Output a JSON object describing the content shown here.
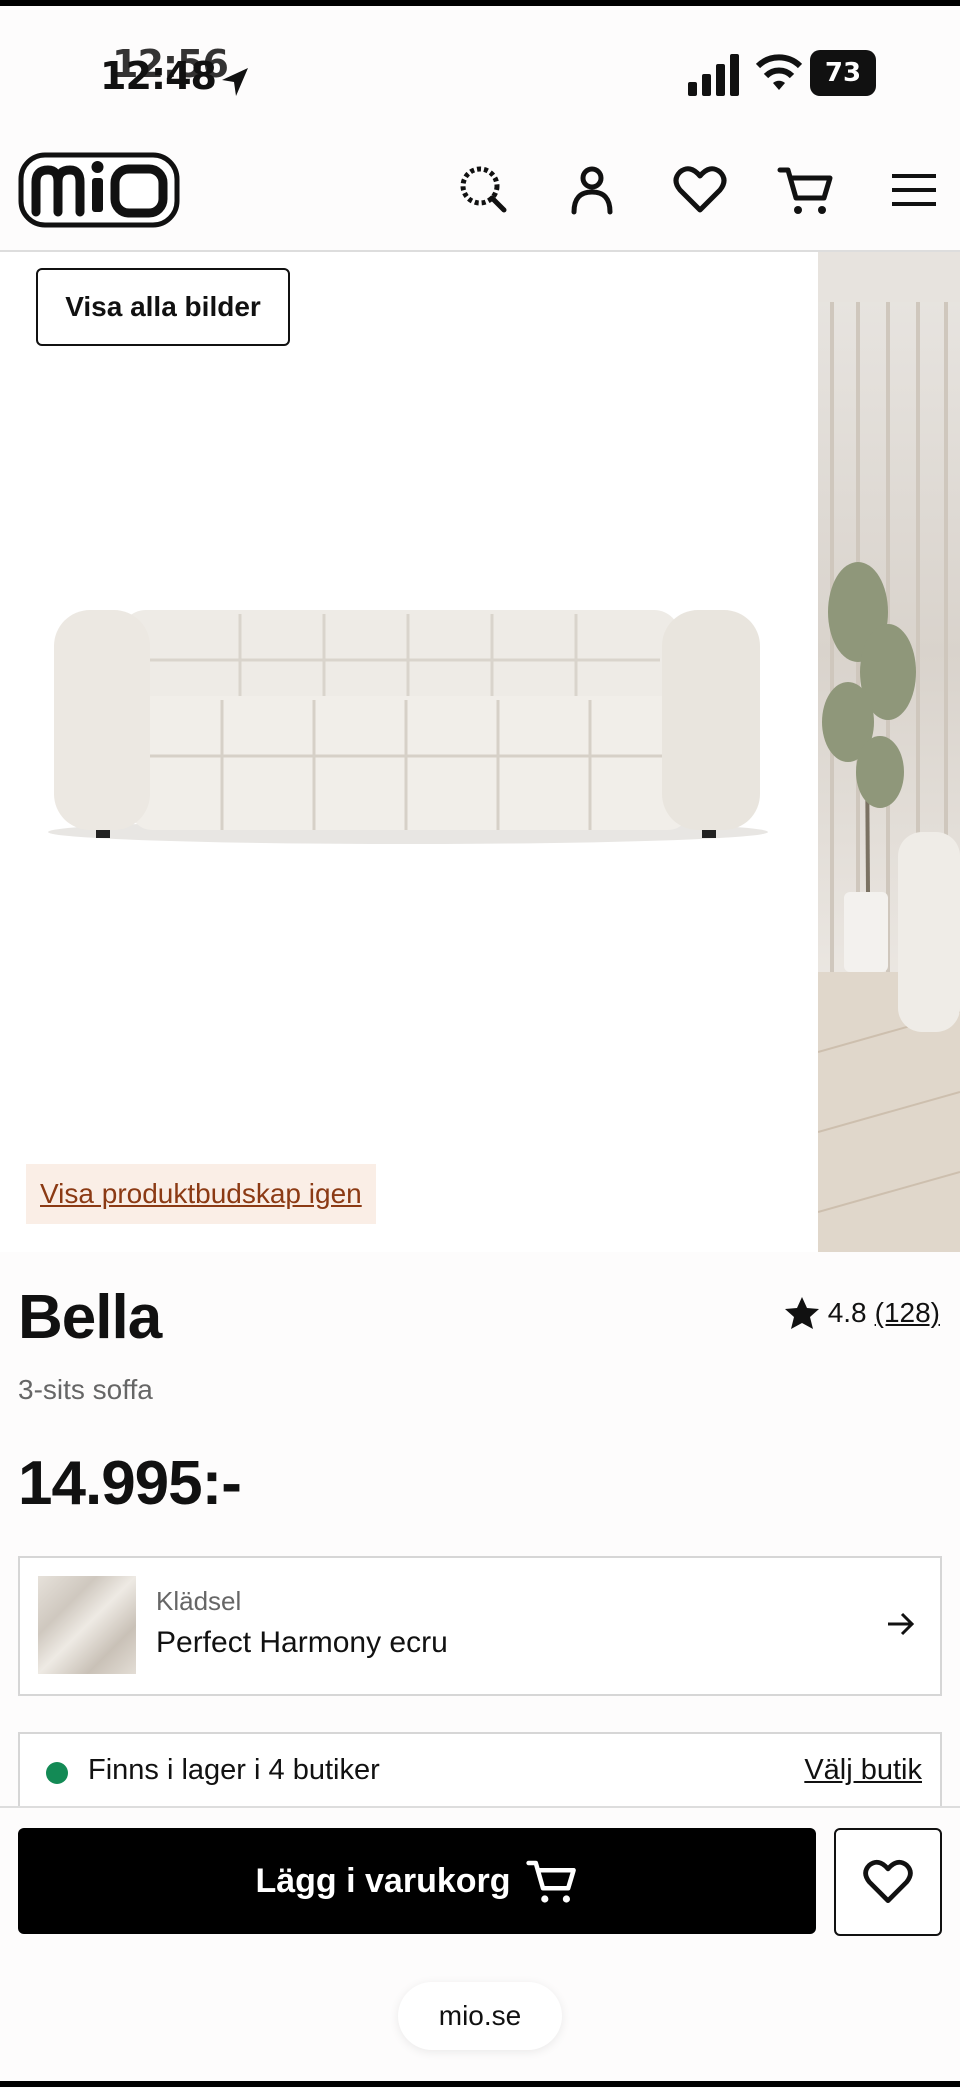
{
  "status_bar": {
    "time_primary": "12:48",
    "time_ghost": "12:56",
    "battery": "73"
  },
  "header": {
    "logo_text": "mio",
    "icons": [
      "search-icon",
      "account-icon",
      "heart-icon",
      "cart-icon",
      "menu-icon"
    ]
  },
  "gallery": {
    "show_all_label": "Visa alla bilder",
    "product_message_link": "Visa produktbudskap igen"
  },
  "product": {
    "name": "Bella",
    "subtitle": "3-sits soffa",
    "rating": "4.8",
    "review_count": "(128)",
    "price": "14.995:-"
  },
  "fabric": {
    "label": "Klädsel",
    "value": "Perfect Harmony ecru"
  },
  "stock": {
    "text": "Finns i lager i 4 butiker",
    "link": "Välj butik",
    "status_color": "#138a55"
  },
  "actions": {
    "add_to_cart": "Lägg i varukorg"
  },
  "browser": {
    "url": "mio.se"
  }
}
